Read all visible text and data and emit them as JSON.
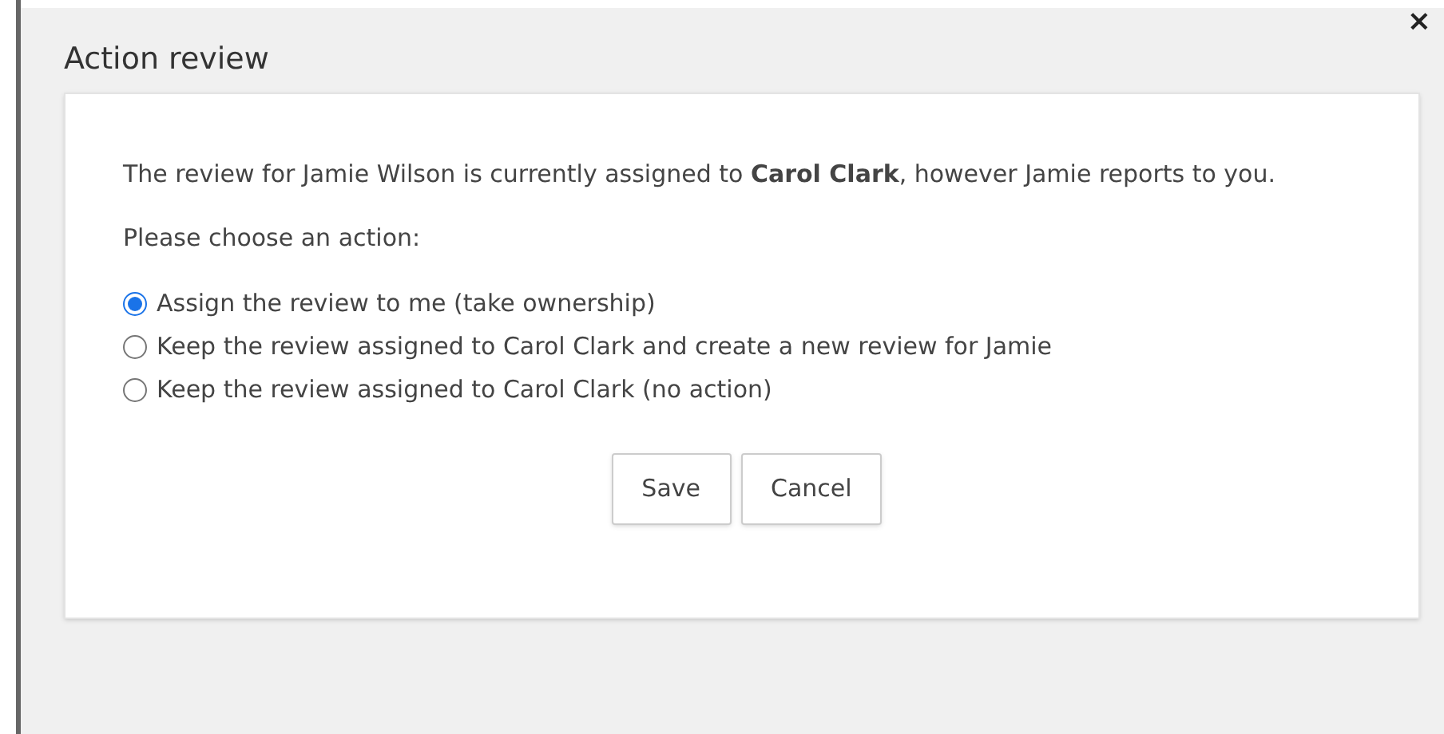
{
  "dialog": {
    "title": "Action review",
    "close": "×"
  },
  "message": "The review for Jamie Wilson is currently assigned to **Carol Clark**, however Jamie reports to you.",
  "prompt": "Please choose an action:",
  "options": [
    {
      "label": "Assign the review to me (take ownership)",
      "selected": true
    },
    {
      "label": "Keep the review assigned to Carol Clark and create a new review for Jamie",
      "selected": false
    },
    {
      "label": "Keep the review assigned to Carol Clark (no action)",
      "selected": false
    }
  ],
  "buttons": [
    "Save",
    "Cancel"
  ]
}
